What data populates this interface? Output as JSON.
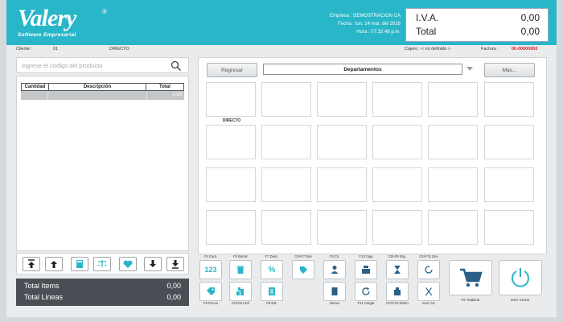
{
  "header": {
    "logo": "Valery",
    "logo_sub": "Software Empresarial",
    "logo_reg": "®",
    "company_line1": "Empresa : DEMOSTRACION CA",
    "company_line2": "Fecha : lun. 14 mar. del 2016",
    "company_line3": "Hora : 07:32:46 p.m.",
    "iva_label": "I.V.A.",
    "iva_value": "0,00",
    "total_label": "Total",
    "total_value": "0,00"
  },
  "infobar": {
    "cliente_label": "Cliente :",
    "cliente_code": "01",
    "cliente_name": "DIRECTO",
    "cajero": "Cajero : < no definido >",
    "factura_label": "Factura :",
    "factura_value": "00-00000002"
  },
  "search": {
    "placeholder": "Ingrese el código del producto"
  },
  "grid": {
    "headers": [
      "Cantidad",
      "Descripción",
      "Total"
    ],
    "row_total": "0,00"
  },
  "summary": {
    "items_label": "Total Items",
    "items_value": "0,00",
    "lines_label": "Total Lineas",
    "lines_value": "0,00"
  },
  "departments": {
    "back_label": "Regresar",
    "selected": "Departamentos",
    "more_label": "Más...",
    "first_tile": "DIRECTO"
  },
  "fkeys_top": [
    "F4 Cant.",
    "F5 Borrar",
    "F7 Desc.",
    "Ctrl-F7 Des",
    "F3 Cli.",
    "F10 Caja",
    "Ctrl-F9 Esp.",
    "Ctrl-F11 Dev"
  ],
  "fkeys_bottom": [
    "F6 Precio",
    "Ctrl-F6 Und",
    "F8 Est.",
    "Nuevo",
    "F11 Cargar",
    "Ctrl-F10 Retiro",
    "Anul. Art."
  ],
  "big_buttons": {
    "totalizar": "F9 Totalizar",
    "cerrar": "ESC Cerrar"
  },
  "fkey_glyphs": {
    "cant": "123",
    "desc": "%",
    "anular": "X"
  },
  "colors": {
    "brand": "#29b6c8",
    "factura": "#d21f1f",
    "dark_panel": "#4a4f55"
  }
}
